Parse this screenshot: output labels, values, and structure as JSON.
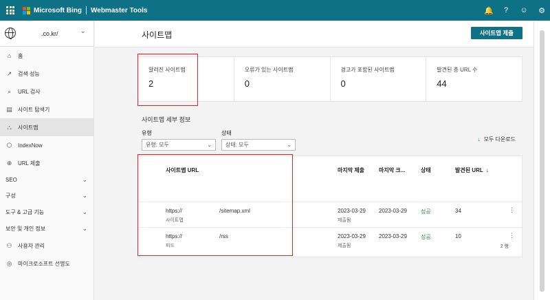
{
  "topbar": {
    "brand": "Microsoft Bing",
    "product": "Webmaster Tools",
    "brand_color": "#0f7186",
    "icons": [
      "bell-icon",
      "help-icon",
      "smiley-icon",
      "gear-icon"
    ],
    "icon_glyphs": {
      "bell": "🔔",
      "help": "?",
      "smiley": "☺",
      "gear": "⚙"
    }
  },
  "sidebar": {
    "site": ".co.kr/",
    "items": [
      {
        "label": "홈",
        "icon": "⌂"
      },
      {
        "label": "검색 성능",
        "icon": "↗"
      },
      {
        "label": "URL 검사",
        "icon": "⌕"
      },
      {
        "label": "사이트 탐색기",
        "icon": "▤"
      },
      {
        "label": "사이트맵",
        "icon": "⛬"
      },
      {
        "label": "IndexNow",
        "icon": "⬡"
      },
      {
        "label": "URL 제출",
        "icon": "⊕"
      }
    ],
    "sections": [
      {
        "label": "SEO"
      },
      {
        "label": "구성"
      },
      {
        "label": "도구 & 고급 기능"
      },
      {
        "label": "보안 및 개인 정보"
      }
    ],
    "footer_items": [
      {
        "label": "사용자 관리",
        "icon": "⚇"
      },
      {
        "label": "마이크로소프트 선명도",
        "icon": "◎"
      }
    ]
  },
  "main": {
    "title": "사이트맵",
    "submit_label": "사이트맵 제출",
    "stats": [
      {
        "label": "알려진 사이트맵",
        "value": "2"
      },
      {
        "label": "오류가 있는 사이트맵",
        "value": "0"
      },
      {
        "label": "경고가 포함된 사이트맵",
        "value": "0"
      },
      {
        "label": "발견된 총 URL 수",
        "value": "44"
      }
    ],
    "detail_title": "사이트맵 세부 정보",
    "filters": {
      "type_label": "유형",
      "type_value": "유형: 모두",
      "status_label": "상태",
      "status_value": "상태: 모두"
    },
    "download_label": "모두 다운로드",
    "table": {
      "headers": {
        "url": "사이트맵 URL",
        "last_submitted": "마지막 제출",
        "last_crawled": "마지막 크...",
        "status": "상태",
        "discovered": "발견된 URL"
      },
      "sort_glyph": "↓",
      "rows": [
        {
          "url_prefix": "https://",
          "url_path": "/sitemap.xml",
          "kind": "사이트맵",
          "last_submitted": "2023-03-29",
          "submitted_note": "제출됨",
          "last_crawled": "2023-03-29",
          "status": "성공",
          "discovered": "34"
        },
        {
          "url_prefix": "https://",
          "url_path": "/rss",
          "kind": "피드",
          "last_submitted": "2023-03-29",
          "submitted_note": "제출됨",
          "last_crawled": "2023-03-29",
          "status": "성공",
          "discovered": "10"
        }
      ],
      "count": "2 행"
    }
  },
  "colors": {
    "accent": "#0f7186",
    "success": "#2f8a3e",
    "highlight": "#e02424"
  }
}
